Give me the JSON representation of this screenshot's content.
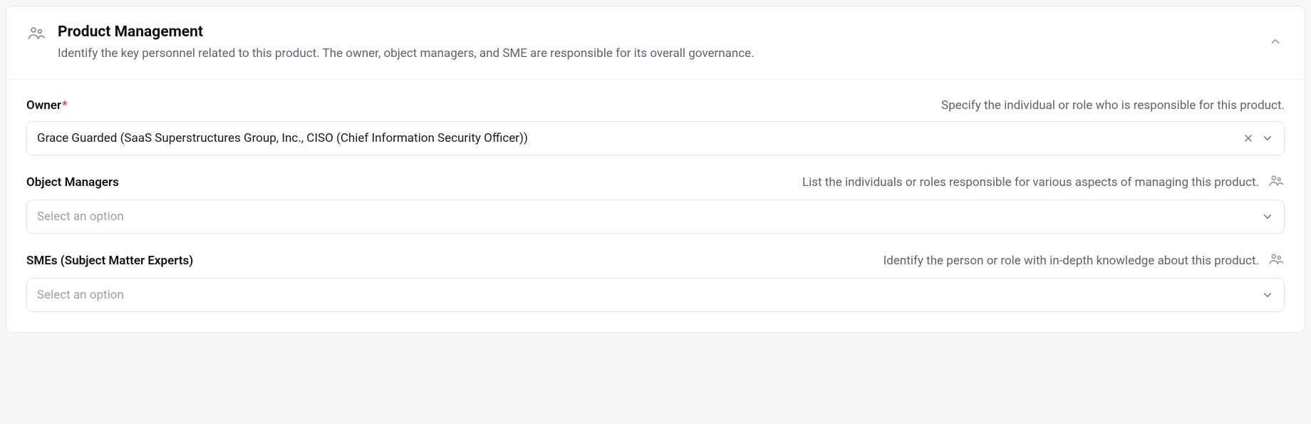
{
  "panel": {
    "title": "Product Management",
    "description": "Identify the key personnel related to this product. The owner, object managers, and SME are responsible for its overall governance."
  },
  "fields": {
    "owner": {
      "label": "Owner",
      "required_mark": "*",
      "help": "Specify the individual or role who is responsible for this product.",
      "value": "Grace Guarded (SaaS Superstructures Group, Inc., CISO (Chief Information Security Officer))"
    },
    "managers": {
      "label": "Object Managers",
      "help": "List the individuals or roles responsible for various aspects of managing this product.",
      "placeholder": "Select an option"
    },
    "smes": {
      "label": "SMEs (Subject Matter Experts)",
      "help": "Identify the person or role with in-depth knowledge about this product.",
      "placeholder": "Select an option"
    }
  }
}
